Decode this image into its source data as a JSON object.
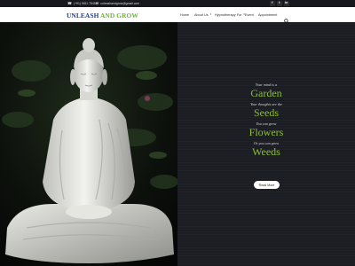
{
  "topbar": {
    "phone": "(+91) 9811 78455",
    "email": "unleashandgrow@gmail.com",
    "social": [
      "f",
      "t",
      "in"
    ]
  },
  "nav": {
    "logo_part1": "UNLEASH",
    "logo_part2": "AND GROW",
    "items": [
      {
        "label": "Home"
      },
      {
        "label": "About Us"
      },
      {
        "label": "Hypnotherapy For"
      },
      {
        "label": "Event"
      },
      {
        "label": "Appointment"
      }
    ]
  },
  "hero": {
    "lines": [
      "Your mind is a",
      "Garden",
      "Your thoughts are the",
      "Seeds",
      "You can grow",
      "Flowers",
      "Or you can grow",
      "Weeds"
    ],
    "button": "Read More"
  },
  "colors": {
    "topbar": "#17181d",
    "accent_green": "#8cbf2c",
    "logo_blue": "#1f3f8c",
    "logo_green": "#6fb23c",
    "panel": "#1b1d23"
  }
}
